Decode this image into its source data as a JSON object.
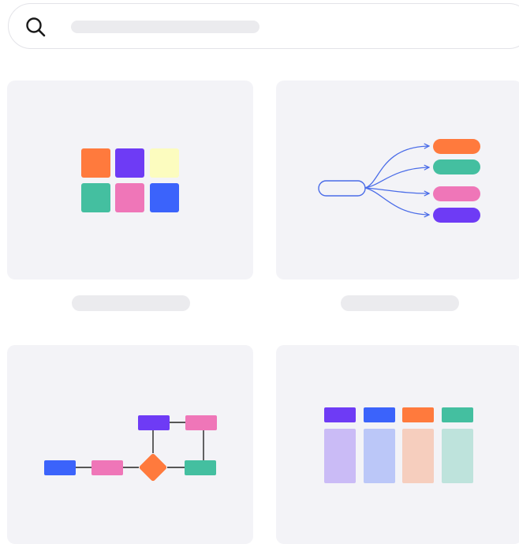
{
  "search": {
    "placeholder": "",
    "value": ""
  },
  "templates": [
    {
      "caption": "",
      "thumbnail-icon": "color-grid-icon"
    },
    {
      "caption": "",
      "thumbnail-icon": "mind-map-icon"
    },
    {
      "caption": "",
      "thumbnail-icon": "flowchart-icon"
    },
    {
      "caption": "",
      "thumbnail-icon": "kanban-board-icon"
    }
  ],
  "colors": {
    "orange": "#ff7a3d",
    "purple": "#6e3bf5",
    "yellow": "#fcfcbf",
    "teal": "#44bfa0",
    "pink": "#ef76b8",
    "blue": "#3b63fb",
    "connector": "#4a6ce8",
    "flow_line": "#222222",
    "card_bg": "#f3f3f7",
    "placeholder_bar": "#ebebee"
  }
}
